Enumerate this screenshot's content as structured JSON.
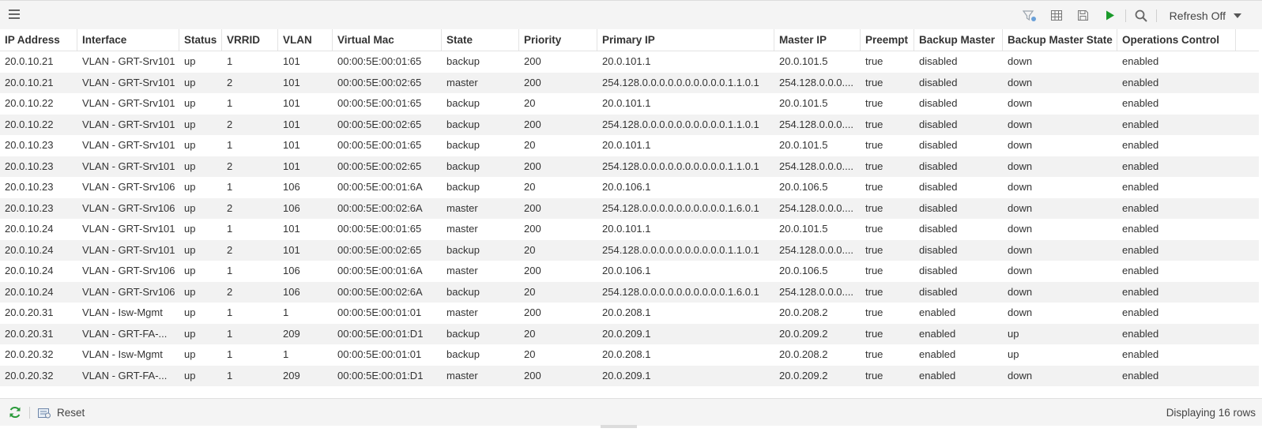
{
  "toolbar": {
    "refresh_label": "Refresh Off",
    "icons": [
      "menu-icon",
      "filter-icon",
      "table-columns-icon",
      "save-icon",
      "play-icon",
      "search-icon",
      "chevron-down-icon"
    ],
    "play_color": "#1a9a2a"
  },
  "table": {
    "columns": [
      "IP Address",
      "Interface",
      "Status",
      "VRRID",
      "VLAN",
      "Virtual Mac",
      "State",
      "Priority",
      "Primary IP",
      "Master IP",
      "Preempt",
      "Backup Master",
      "Backup Master State",
      "Operations Control"
    ],
    "rows": [
      [
        "20.0.10.21",
        "VLAN - GRT-Srv101",
        "up",
        "1",
        "101",
        "00:00:5E:00:01:65",
        "backup",
        "200",
        "20.0.101.1",
        "20.0.101.5",
        "true",
        "disabled",
        "down",
        "enabled"
      ],
      [
        "20.0.10.21",
        "VLAN - GRT-Srv101",
        "up",
        "2",
        "101",
        "00:00:5E:00:02:65",
        "master",
        "200",
        "254.128.0.0.0.0.0.0.0.0.0.0.1.1.0.1",
        "254.128.0.0.0....",
        "true",
        "disabled",
        "down",
        "enabled"
      ],
      [
        "20.0.10.22",
        "VLAN - GRT-Srv101",
        "up",
        "1",
        "101",
        "00:00:5E:00:01:65",
        "backup",
        "20",
        "20.0.101.1",
        "20.0.101.5",
        "true",
        "disabled",
        "down",
        "enabled"
      ],
      [
        "20.0.10.22",
        "VLAN - GRT-Srv101",
        "up",
        "2",
        "101",
        "00:00:5E:00:02:65",
        "backup",
        "200",
        "254.128.0.0.0.0.0.0.0.0.0.0.1.1.0.1",
        "254.128.0.0.0....",
        "true",
        "disabled",
        "down",
        "enabled"
      ],
      [
        "20.0.10.23",
        "VLAN - GRT-Srv101",
        "up",
        "1",
        "101",
        "00:00:5E:00:01:65",
        "backup",
        "20",
        "20.0.101.1",
        "20.0.101.5",
        "true",
        "disabled",
        "down",
        "enabled"
      ],
      [
        "20.0.10.23",
        "VLAN - GRT-Srv101",
        "up",
        "2",
        "101",
        "00:00:5E:00:02:65",
        "backup",
        "200",
        "254.128.0.0.0.0.0.0.0.0.0.0.1.1.0.1",
        "254.128.0.0.0....",
        "true",
        "disabled",
        "down",
        "enabled"
      ],
      [
        "20.0.10.23",
        "VLAN - GRT-Srv106",
        "up",
        "1",
        "106",
        "00:00:5E:00:01:6A",
        "backup",
        "20",
        "20.0.106.1",
        "20.0.106.5",
        "true",
        "disabled",
        "down",
        "enabled"
      ],
      [
        "20.0.10.23",
        "VLAN - GRT-Srv106",
        "up",
        "2",
        "106",
        "00:00:5E:00:02:6A",
        "master",
        "200",
        "254.128.0.0.0.0.0.0.0.0.0.0.1.6.0.1",
        "254.128.0.0.0....",
        "true",
        "disabled",
        "down",
        "enabled"
      ],
      [
        "20.0.10.24",
        "VLAN - GRT-Srv101",
        "up",
        "1",
        "101",
        "00:00:5E:00:01:65",
        "master",
        "200",
        "20.0.101.1",
        "20.0.101.5",
        "true",
        "disabled",
        "down",
        "enabled"
      ],
      [
        "20.0.10.24",
        "VLAN - GRT-Srv101",
        "up",
        "2",
        "101",
        "00:00:5E:00:02:65",
        "backup",
        "20",
        "254.128.0.0.0.0.0.0.0.0.0.0.1.1.0.1",
        "254.128.0.0.0....",
        "true",
        "disabled",
        "down",
        "enabled"
      ],
      [
        "20.0.10.24",
        "VLAN - GRT-Srv106",
        "up",
        "1",
        "106",
        "00:00:5E:00:01:6A",
        "master",
        "200",
        "20.0.106.1",
        "20.0.106.5",
        "true",
        "disabled",
        "down",
        "enabled"
      ],
      [
        "20.0.10.24",
        "VLAN - GRT-Srv106",
        "up",
        "2",
        "106",
        "00:00:5E:00:02:6A",
        "backup",
        "20",
        "254.128.0.0.0.0.0.0.0.0.0.0.1.6.0.1",
        "254.128.0.0.0....",
        "true",
        "disabled",
        "down",
        "enabled"
      ],
      [
        "20.0.20.31",
        "VLAN - Isw-Mgmt",
        "up",
        "1",
        "1",
        "00:00:5E:00:01:01",
        "master",
        "200",
        "20.0.208.1",
        "20.0.208.2",
        "true",
        "enabled",
        "down",
        "enabled"
      ],
      [
        "20.0.20.31",
        "VLAN - GRT-FA-...",
        "up",
        "1",
        "209",
        "00:00:5E:00:01:D1",
        "backup",
        "20",
        "20.0.209.1",
        "20.0.209.2",
        "true",
        "enabled",
        "up",
        "enabled"
      ],
      [
        "20.0.20.32",
        "VLAN - Isw-Mgmt",
        "up",
        "1",
        "1",
        "00:00:5E:00:01:01",
        "backup",
        "20",
        "20.0.208.1",
        "20.0.208.2",
        "true",
        "enabled",
        "up",
        "enabled"
      ],
      [
        "20.0.20.32",
        "VLAN - GRT-FA-...",
        "up",
        "1",
        "209",
        "00:00:5E:00:01:D1",
        "master",
        "200",
        "20.0.209.1",
        "20.0.209.2",
        "true",
        "enabled",
        "down",
        "enabled"
      ]
    ]
  },
  "footer": {
    "reset_label": "Reset",
    "status_text": "Displaying 16 rows",
    "refresh_icon_color": "#2a9a3a"
  }
}
